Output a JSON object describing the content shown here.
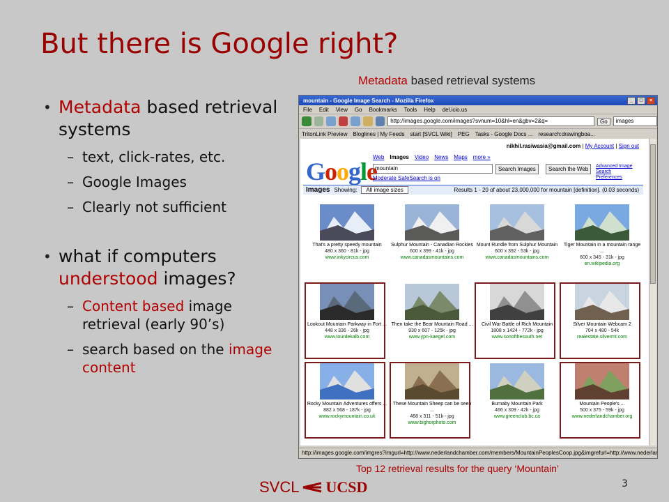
{
  "slide": {
    "title": "But there is Google right?",
    "meta_caption_red": "Metadata",
    "meta_caption_rest": " based retrieval systems",
    "bottom_caption": "Top 12 retrieval results for the query ‘Mountain’",
    "footer_svcl": "SVCL",
    "footer_ucsd": "UCSD",
    "page_number": "3"
  },
  "bullets": {
    "b1_red": "Metadata",
    "b1_rest": " based retrieval systems",
    "b1_sub": [
      "text, click-rates, etc.",
      "Google Images",
      "Clearly not sufficient"
    ],
    "b2_pre": "what if computers ",
    "b2_red": "understood",
    "b2_post": " images?",
    "b2_sub1_red": "Content based",
    "b2_sub1_rest": " image retrieval (early 90’s)",
    "b2_sub2_pre": "search based on the ",
    "b2_sub2_red": "image content"
  },
  "browser": {
    "window_title": "mountain - Google Image Search - Mozilla Firefox",
    "menu": [
      "File",
      "Edit",
      "View",
      "Go",
      "Bookmarks",
      "Tools",
      "Help",
      "del.icio.us"
    ],
    "url": "http://images.google.com/images?svnum=10&hl=en&gbv=2&q=",
    "go_label": "Go",
    "search_box": "images",
    "bookmarks": [
      "TritonLink Preview",
      "Bloglines | My Feeds",
      "start [SVCL Wiki]",
      "PEG",
      "Tasks - Google Docs ...",
      "research:drawingboa..."
    ],
    "status_text": "http://images.google.com/imgres?imgurl=http://www.nederlandchamber.com/members/MountainPeoplesCoop.jpg&imgrefurl=http://www.nederlandchamber...."
  },
  "google": {
    "user_email": "nikhil.rasiwasia@gmail.com",
    "my_account": "My Account",
    "sign_out": "Sign out",
    "logo_letters": [
      "G",
      "o",
      "o",
      "g",
      "l",
      "e"
    ],
    "logo_colors": [
      "#3366cc",
      "#cc2200",
      "#ffaa00",
      "#3366cc",
      "#009933",
      "#cc2200"
    ],
    "tabs": [
      "Web",
      "Images",
      "Video",
      "News",
      "Maps",
      "more »"
    ],
    "query": "mountain",
    "search_images_btn": "Search Images",
    "search_web_btn": "Search the Web",
    "advanced": "Advanced Image Search",
    "preferences": "Preferences",
    "safesearch": "Moderate SafeSearch is on",
    "images_label": "Images",
    "showing_label": "Showing:",
    "size_option": "All image sizes",
    "results_text": "Results 1 - 20 of about 23,000,000 for mountain [definition]. (0.03 seconds)"
  },
  "results": [
    {
      "caption": "That's a pretty speedy mountain",
      "dims": "480 x 360 - 81k - jpg",
      "host": "www.inkycircus.com",
      "selected": false
    },
    {
      "caption": "Sulphur Mountain - Canadian Rockies",
      "dims": "600 x 399 - 41k - jpg",
      "host": "www.canadasmountains.com",
      "selected": false
    },
    {
      "caption": "Mount Rundle from Sulphur Mountain",
      "dims": "600 x 392 - 53k - jpg",
      "host": "www.canadasmountains.com",
      "selected": false
    },
    {
      "caption": "Tiger Mountain in a mountain range ...",
      "dims": "600 x 345 - 31k - jpg",
      "host": "en.wikipedia.org",
      "selected": false
    },
    {
      "caption": "Lookout Mountain Parkway in Fort ...",
      "dims": "448 x 336 - 26k - jpg",
      "host": "www.tourdekalb.com",
      "selected": true
    },
    {
      "caption": "Then take the Bear Mountain Road ...",
      "dims": "930 x 607 - 125k - jpg",
      "host": "www.ypn-kaegel.com",
      "selected": false
    },
    {
      "caption": "Civil War Battle of Rich Mountain",
      "dims": "1808 x 1424 - 772k - jpg",
      "host": "www.sonofthesouth.net",
      "selected": true
    },
    {
      "caption": "Silver Mountain Webcam 2",
      "dims": "704 x 480 - 54k",
      "host": "realestate.silvermt.com",
      "selected": true
    },
    {
      "caption": "Rocky Mountain Adventures offers ...",
      "dims": "882 x 568 - 187k - jpg",
      "host": "www.rockymountain.co.uk",
      "selected": true
    },
    {
      "caption": "These Mountain Sheep can be seen ...",
      "dims": "468 x 311 - 51k - jpg",
      "host": "www.bighorphoto.com",
      "selected": true
    },
    {
      "caption": "Burnaby Mountain Park",
      "dims": "466 x 309 - 42k - jpg",
      "host": "www.greenclub.bc.ca",
      "selected": false
    },
    {
      "caption": "Mountain People's ...",
      "dims": "500 x 375 - 59k - jpg",
      "host": "www.nederlandchamber.org",
      "selected": true
    }
  ]
}
